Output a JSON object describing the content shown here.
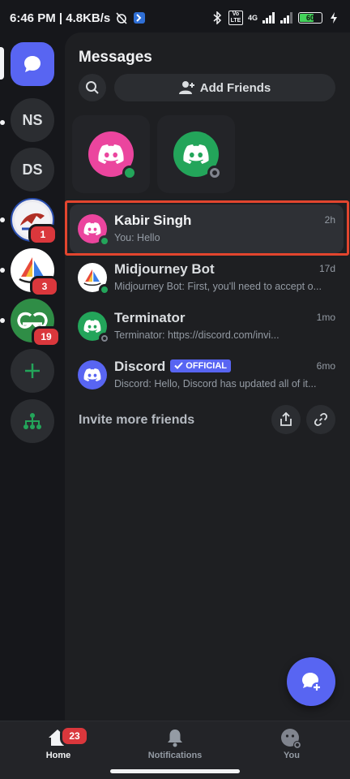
{
  "status_bar": {
    "time_speed": "6:46 PM | 4.8KB/s",
    "network_label": "4G",
    "volte_label": "Vo LTE",
    "battery_level": "60"
  },
  "rail": {
    "servers": [
      {
        "label": "NS"
      },
      {
        "label": "DS"
      },
      {
        "badge": "1"
      },
      {
        "badge": "3"
      },
      {
        "badge": "19"
      }
    ]
  },
  "messages": {
    "title": "Messages",
    "add_friends_label": "Add Friends",
    "conversations": [
      {
        "name": "Kabir Singh",
        "preview": "You: Hello",
        "time": "2h"
      },
      {
        "name": "Midjourney Bot",
        "preview": "Midjourney Bot: First, you'll need to accept o...",
        "time": "17d"
      },
      {
        "name": "Terminator",
        "preview": "Terminator: https://discord.com/invi...",
        "time": "1mo"
      },
      {
        "name": "Discord",
        "official": "OFFICIAL",
        "preview": "Discord: Hello, Discord has updated all of it...",
        "time": "6mo"
      }
    ],
    "invite_label": "Invite more friends"
  },
  "bottom_nav": {
    "home_label": "Home",
    "home_badge": "23",
    "notifications_label": "Notifications",
    "you_label": "You"
  },
  "colors": {
    "blurple": "#5865f2",
    "pink": "#eb459e",
    "green": "#23a55a",
    "online": "#23a55a",
    "idle_gray": "#80848e",
    "badge_red": "#da373c",
    "highlight": "#e2452e"
  }
}
